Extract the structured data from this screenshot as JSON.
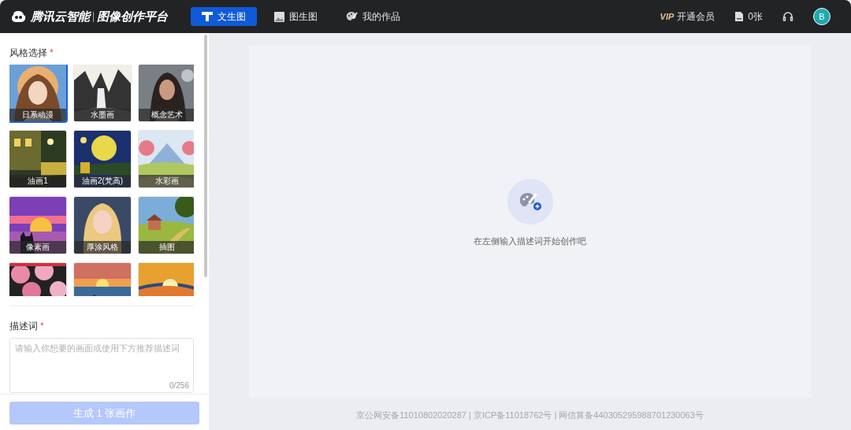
{
  "header": {
    "brand": "腾讯云智能",
    "product": "图像创作平台",
    "nav": [
      {
        "label": "文生图",
        "selected": true
      },
      {
        "label": "图生图",
        "selected": false
      },
      {
        "label": "我的作品",
        "selected": false
      }
    ],
    "vip_badge": "VIP",
    "vip_label": "开通会员",
    "quota": "0张",
    "avatar": "B"
  },
  "style_section": {
    "title": "风格选择",
    "required_mark": "*",
    "styles": [
      {
        "label": "日系动漫",
        "selected": true
      },
      {
        "label": "水墨画",
        "selected": false
      },
      {
        "label": "概念艺术",
        "selected": false
      },
      {
        "label": "油画1",
        "selected": false
      },
      {
        "label": "油画2(梵高)",
        "selected": false
      },
      {
        "label": "水彩画",
        "selected": false
      },
      {
        "label": "像素画",
        "selected": false
      },
      {
        "label": "厚涂风格",
        "selected": false
      },
      {
        "label": "插图",
        "selected": false
      },
      {
        "selected": false
      },
      {
        "selected": false
      },
      {
        "selected": false
      }
    ]
  },
  "prompt_section": {
    "title": "描述词",
    "required_mark": "*",
    "placeholder": "请输入你想要的画面或使用下方推荐描述词",
    "counter": "0/256"
  },
  "generate_button": {
    "label": "生成 1 张画作",
    "disabled": true
  },
  "canvas": {
    "empty_message": "在左侧输入描述词开始创作吧"
  },
  "footer": "京公网安备11010802020287 | 京ICP备11018762号 | 网信算备440305295988701230063号"
}
